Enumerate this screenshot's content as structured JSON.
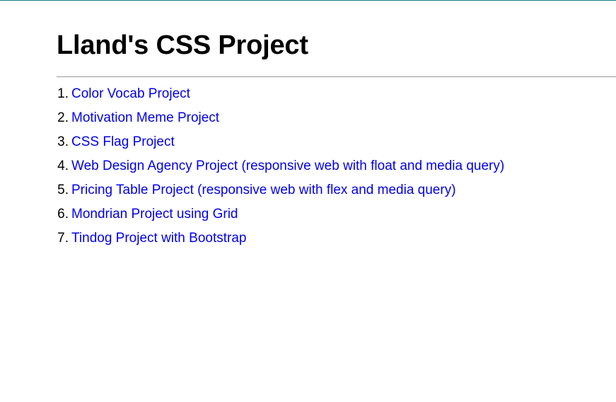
{
  "page": {
    "title": "Lland's CSS Project"
  },
  "projects": [
    {
      "number": "1.",
      "label": "Color Vocab Project"
    },
    {
      "number": "2.",
      "label": "Motivation Meme Project"
    },
    {
      "number": "3.",
      "label": "CSS Flag Project"
    },
    {
      "number": "4.",
      "label": "Web Design Agency Project (responsive web with float and media query)"
    },
    {
      "number": "5.",
      "label": "Pricing Table Project (responsive web with flex and media query)"
    },
    {
      "number": "6.",
      "label": "Mondrian Project using Grid"
    },
    {
      "number": "7.",
      "label": "Tindog Project with Bootstrap"
    }
  ],
  "colors": {
    "link": "#0000ee",
    "text": "#000000",
    "rule": "#9a9a9a",
    "top_strip": "#0f7f8a"
  }
}
